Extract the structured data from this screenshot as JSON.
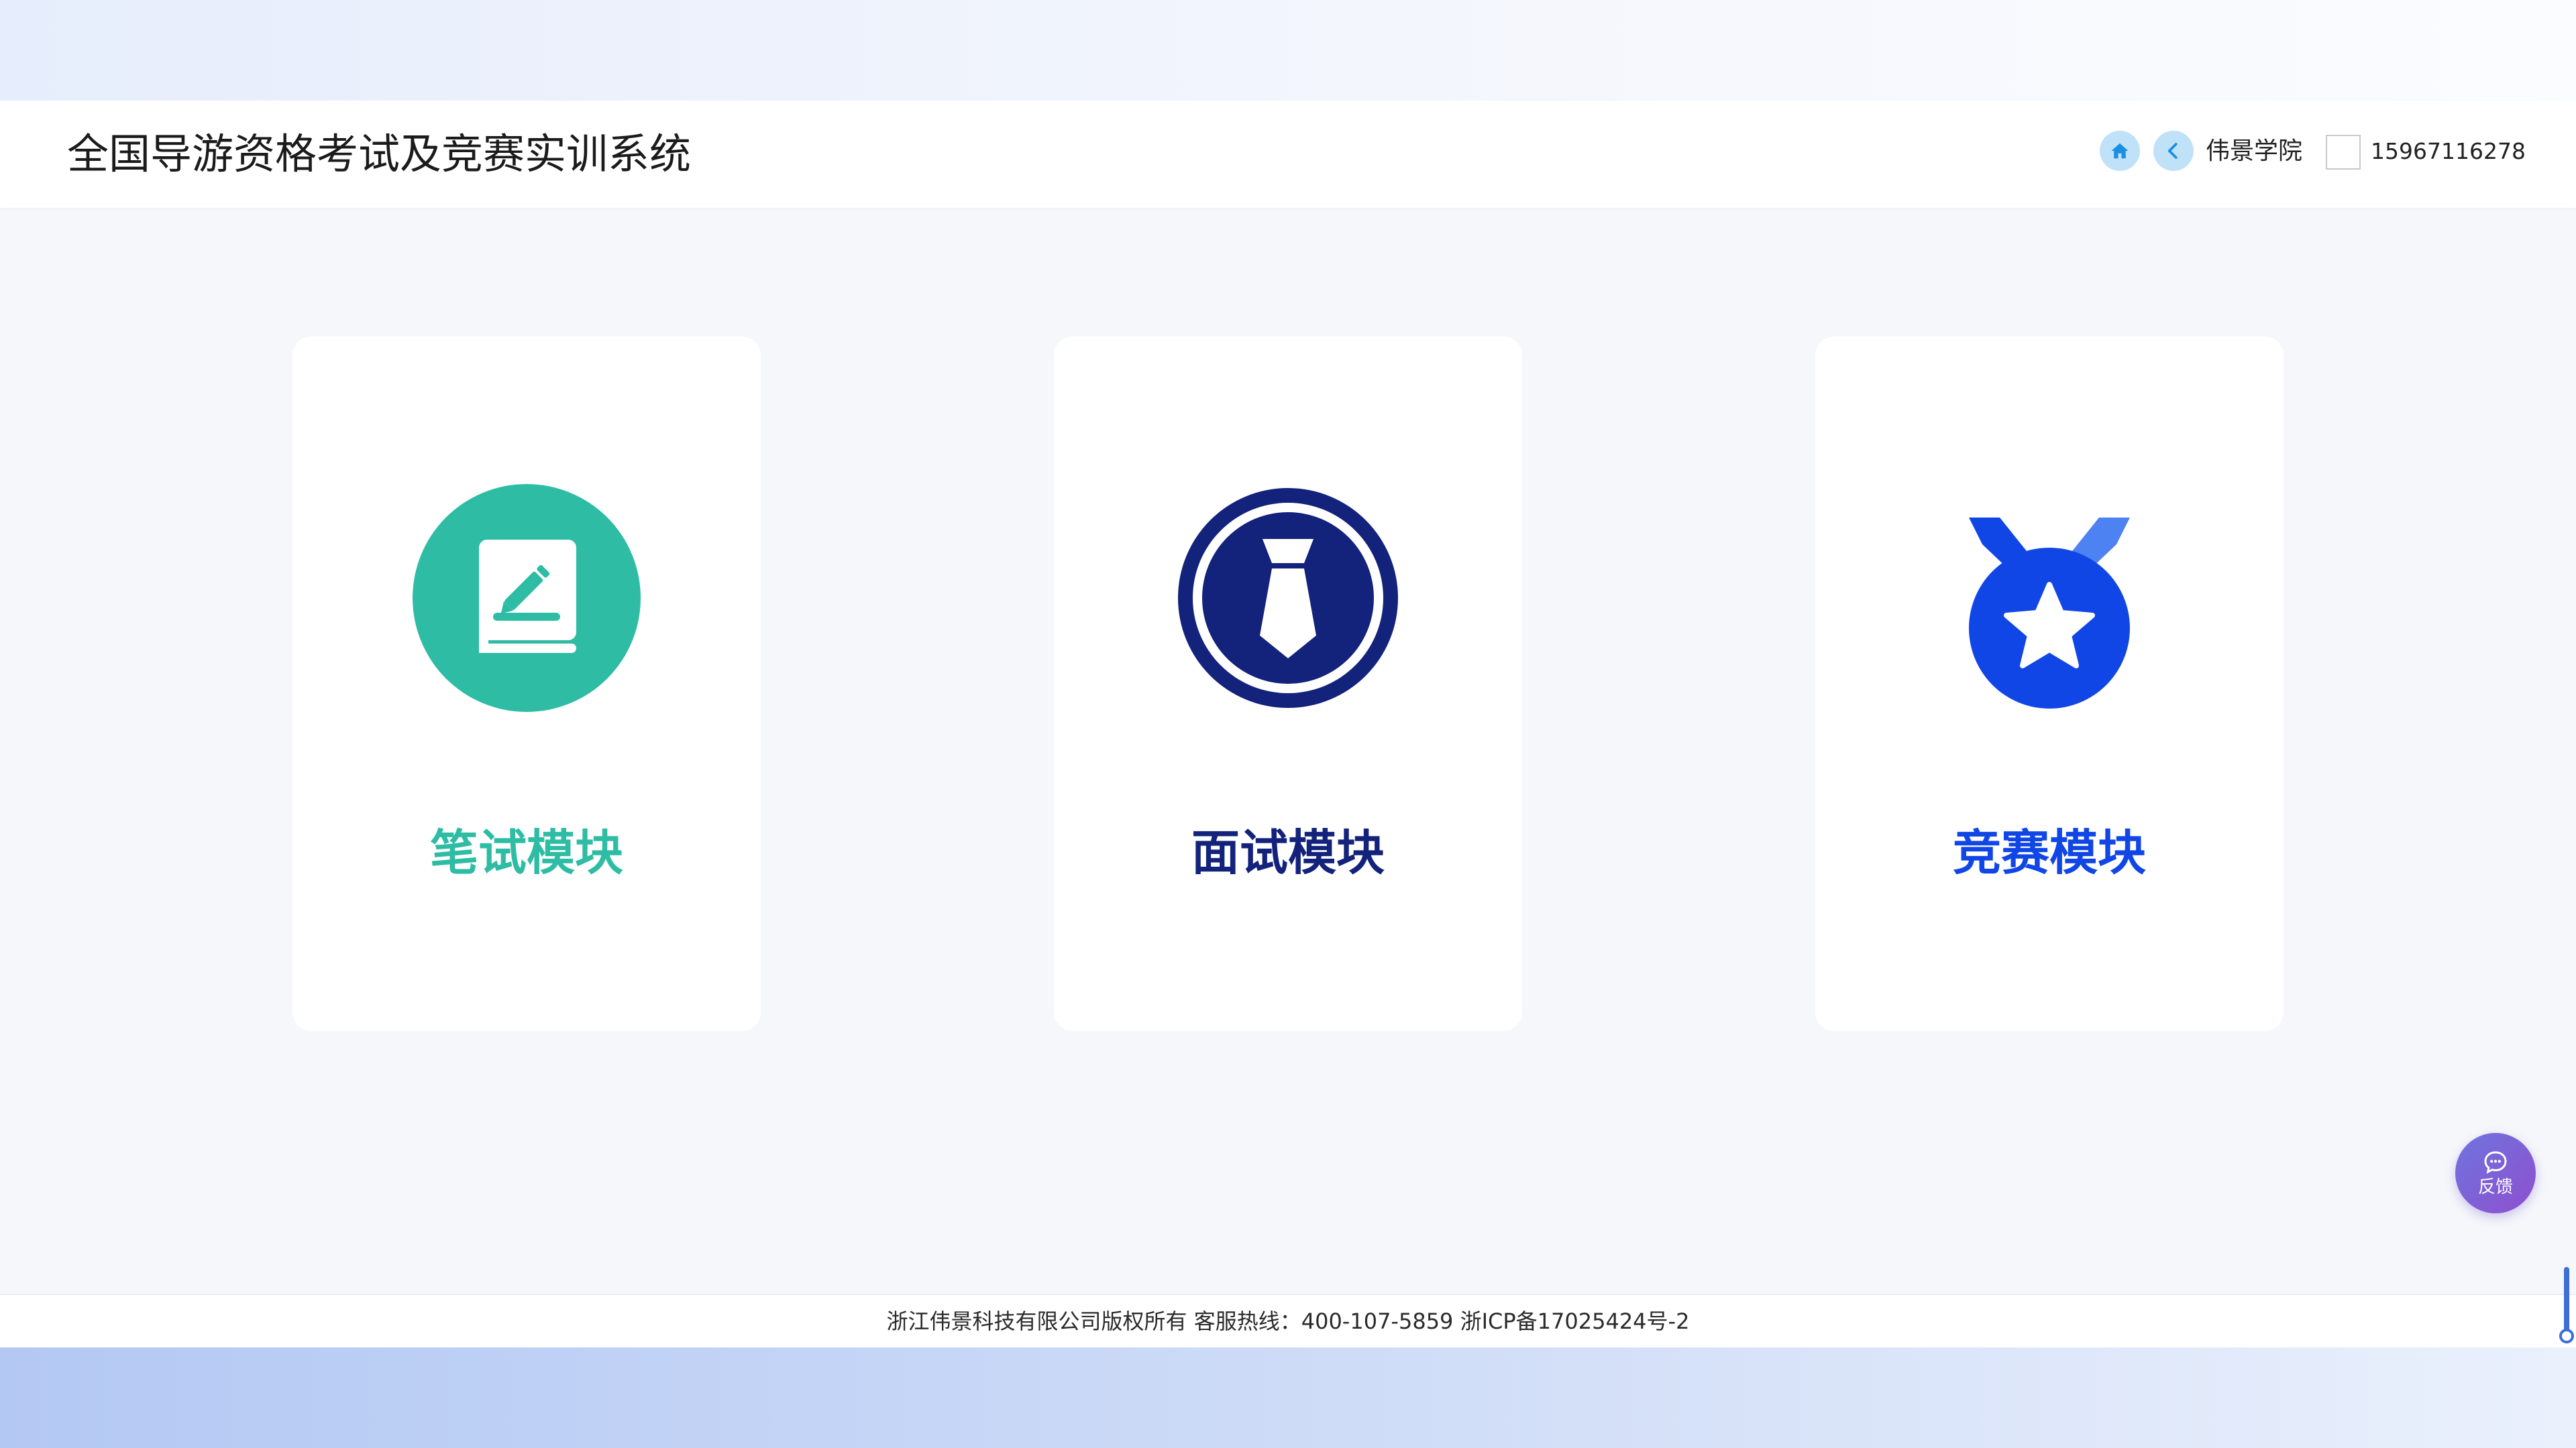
{
  "app": {
    "title": "全国导游资格考试及竞赛实训系统"
  },
  "header": {
    "home_icon": "home-icon",
    "back_icon": "chevron-left-icon",
    "organization": "伟景学院",
    "phone": "15967116278"
  },
  "modules": [
    {
      "label": "笔试模块",
      "icon": "book-edit-icon",
      "color": "#2EBDA4"
    },
    {
      "label": "面试模块",
      "icon": "tie-icon",
      "color": "#13237B"
    },
    {
      "label": "竞赛模块",
      "icon": "medal-star-icon",
      "color": "#1146E6"
    }
  ],
  "footer": {
    "text": "浙江伟景科技有限公司版权所有 客服热线：400-107-5859 浙ICP备17025424号-2"
  },
  "feedback": {
    "label": "反馈",
    "icon": "chat-bubble-icon"
  },
  "colors": {
    "accent_light_blue": "#BFE2F8",
    "feedback_purple": "#7A63D8"
  }
}
